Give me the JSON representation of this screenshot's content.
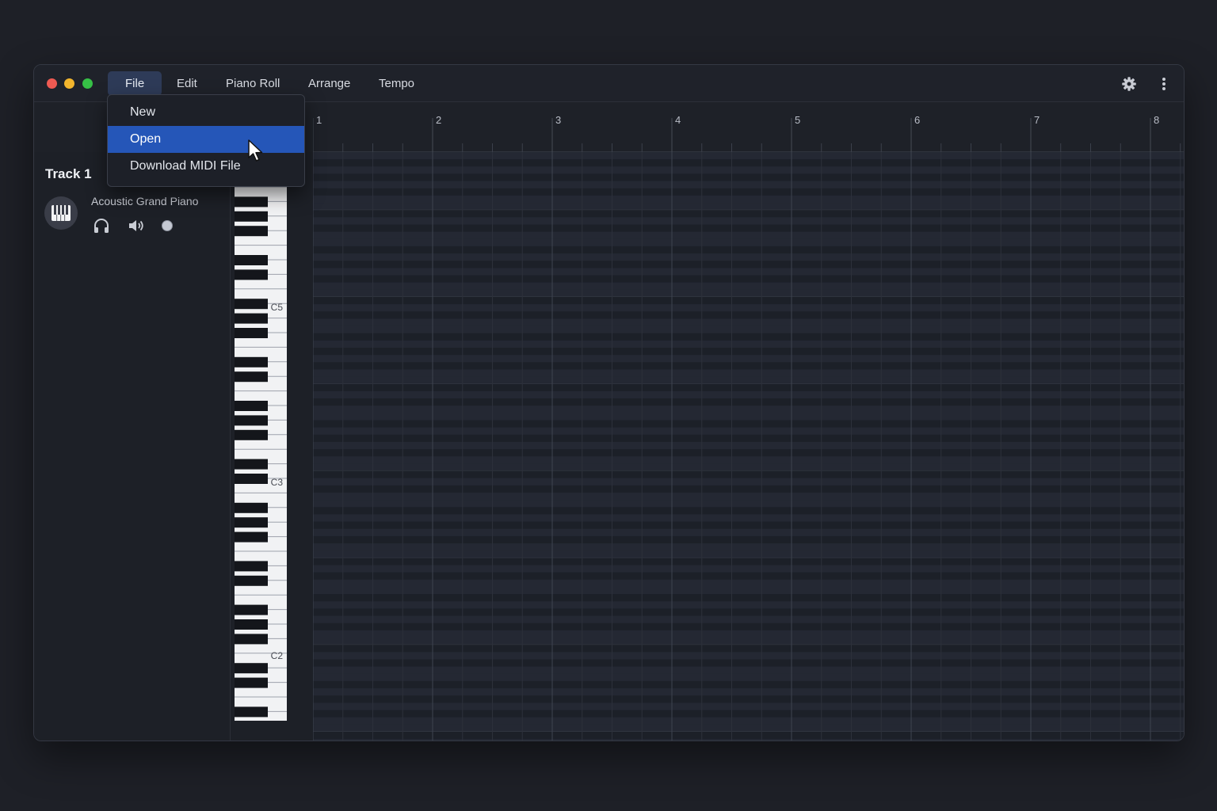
{
  "window": {
    "traffic_lights": [
      "close",
      "minimize",
      "zoom"
    ]
  },
  "menubar": {
    "items": [
      {
        "label": "File",
        "active": true
      },
      {
        "label": "Edit"
      },
      {
        "label": "Piano Roll"
      },
      {
        "label": "Arrange"
      },
      {
        "label": "Tempo"
      }
    ],
    "right_icons": [
      "gear-icon",
      "more-vertical-icon"
    ]
  },
  "file_menu": {
    "items": [
      {
        "label": "New"
      },
      {
        "label": "Open",
        "highlighted": true
      },
      {
        "label": "Download MIDI File"
      }
    ]
  },
  "track": {
    "name": "Track 1",
    "instrument": "Acoustic Grand Piano",
    "icons": [
      "piano-icon",
      "headphones-icon",
      "speaker-icon",
      "record-dot-icon"
    ]
  },
  "ruler": {
    "bars": [
      "1",
      "2",
      "3",
      "4",
      "5",
      "6",
      "7",
      "8"
    ],
    "subdivisions_per_bar": 4
  },
  "piano": {
    "octave_labels": [
      "C5",
      "C3",
      "C2"
    ]
  },
  "colors": {
    "accent": "#2556b8",
    "menu_active": "#2e3b58",
    "background": "#1e2027",
    "traffic_red": "#ee5a52",
    "traffic_yellow": "#f2b52d",
    "traffic_green": "#36c046"
  }
}
